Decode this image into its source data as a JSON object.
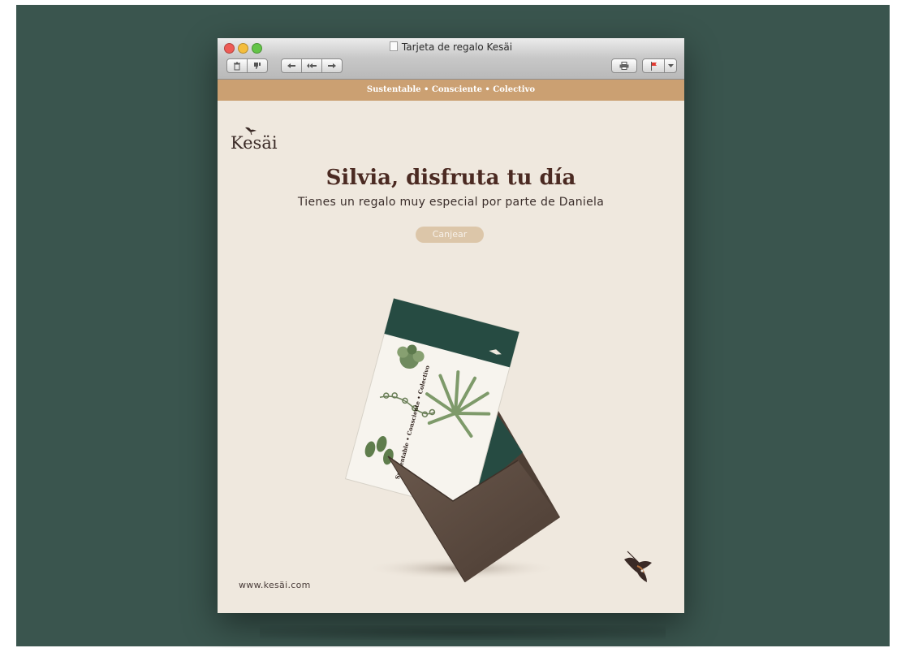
{
  "window": {
    "title": "Tarjeta de regalo Kesäi"
  },
  "toolbar": {
    "delete_icon": "trash-icon",
    "junk_icon": "thumbs-down-icon",
    "reply_icon": "reply-arrow-icon",
    "reply_all_icon": "reply-all-arrow-icon",
    "forward_icon": "forward-arrow-icon",
    "print_icon": "printer-icon",
    "flag_icon": "flag-icon",
    "flag_menu_icon": "chevron-down-icon"
  },
  "email": {
    "banner_text": "Sustentable • Consciente • Colectivo",
    "brand_name": "Kesäi",
    "headline": "Silvia, disfruta tu día",
    "subheadline": "Tienes un regalo muy especial por parte de Daniela",
    "cta_label": "Canjear",
    "footer_url": "www.kesäi.com",
    "card_text": "Sustentable • Consciente • Colectivo"
  },
  "colors": {
    "background": "#3a554e",
    "email_background": "#efe8de",
    "banner": "#cba072",
    "headline": "#4b2a22",
    "button": "#dcc6a9",
    "card_dark": "#264b42",
    "envelope": "#5b4a3f"
  }
}
